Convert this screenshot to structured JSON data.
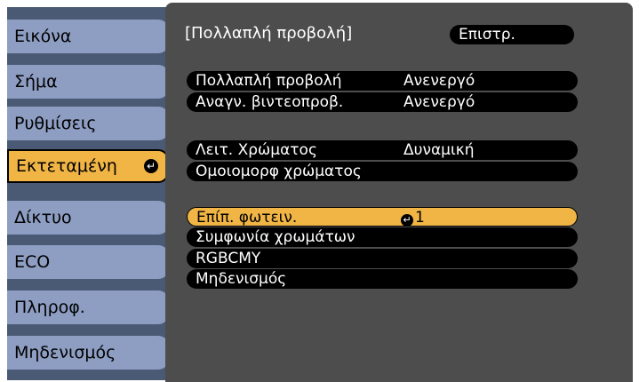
{
  "sidebar": {
    "items": [
      {
        "label": "Εικόνα"
      },
      {
        "label": "Σήμα"
      },
      {
        "label": "Ρυθμίσεις"
      },
      {
        "label": "Εκτεταμένη"
      },
      {
        "label": "Δίκτυο"
      },
      {
        "label": "ECO"
      },
      {
        "label": "Πληροφ."
      },
      {
        "label": "Μηδενισμός"
      }
    ],
    "active_index": 3,
    "enter_glyph": "↵"
  },
  "header": {
    "title": "[Πολλαπλή προβολή]",
    "back_label": "Επιστρ."
  },
  "menu": {
    "rows": [
      {
        "label": "Πολλαπλή προβολή",
        "value": "Ανενεργό"
      },
      {
        "label": "Αναγν. βιντεοπροβ.",
        "value": "Ανενεργό"
      },
      {
        "label": "Λειτ. Χρώματος",
        "value": "Δυναμική"
      },
      {
        "label": "Ομοιομορφ χρώματος",
        "value": ""
      },
      {
        "label": "Επίπ. φωτειν.",
        "value": "1",
        "selected": true
      },
      {
        "label": "Συμφωνία χρωμάτων",
        "value": ""
      },
      {
        "label": "RGBCMY",
        "value": ""
      },
      {
        "label": "Μηδενισμός",
        "value": ""
      }
    ]
  },
  "colors": {
    "sidebar_item": "#8e9ec3",
    "accent": "#f0b545",
    "panel": "#4d4d4d",
    "row": "#000000"
  }
}
